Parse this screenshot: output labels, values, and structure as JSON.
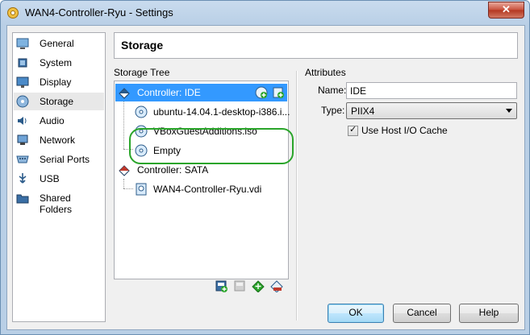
{
  "window": {
    "title": "WAN4-Controller-Ryu - Settings",
    "close_glyph": "✕"
  },
  "sidebar": {
    "items": [
      {
        "label": "General",
        "icon": "monitor-icon"
      },
      {
        "label": "System",
        "icon": "chip-icon"
      },
      {
        "label": "Display",
        "icon": "display-icon"
      },
      {
        "label": "Storage",
        "icon": "disk-icon",
        "selected": true
      },
      {
        "label": "Audio",
        "icon": "speaker-icon"
      },
      {
        "label": "Network",
        "icon": "network-icon"
      },
      {
        "label": "Serial Ports",
        "icon": "serial-port-icon"
      },
      {
        "label": "USB",
        "icon": "usb-icon"
      },
      {
        "label": "Shared Folders",
        "icon": "folder-icon"
      }
    ]
  },
  "header": {
    "title": "Storage"
  },
  "storage_tree": {
    "title": "Storage Tree",
    "controller_ide": "Controller: IDE",
    "ide_items": [
      "ubuntu-14.04.1-desktop-i386.i...",
      "VBoxGuestAdditions.iso",
      "Empty"
    ],
    "controller_sata": "Controller: SATA",
    "sata_items": [
      "WAN4-Controller-Ryu.vdi"
    ]
  },
  "attributes": {
    "title": "Attributes",
    "name_label": "Name:",
    "name_value": "IDE",
    "type_label": "Type:",
    "type_value": "PIIX4",
    "host_cache_label": "Use Host I/O Cache",
    "host_cache_checked": true,
    "check_glyph": "✓"
  },
  "buttons": {
    "ok": "OK",
    "cancel": "Cancel",
    "help": "Help"
  },
  "colors": {
    "selection": "#3399ff",
    "annotation": "#2aa52a"
  }
}
